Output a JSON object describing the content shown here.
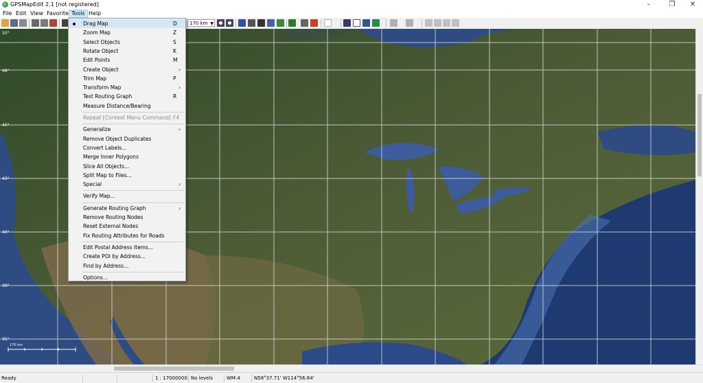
{
  "window": {
    "title": "GPSMapEdit 2.1 [not registered]",
    "controls": [
      "–",
      "❐",
      "✕"
    ]
  },
  "menubar": [
    "File",
    "Edit",
    "View",
    "Favorites",
    "Tools",
    "Help"
  ],
  "toolbar": {
    "scale": "170 km",
    "icons": [
      "open-icon",
      "save-icon",
      "save-as-icon",
      "print-icon",
      "print-preview-icon",
      "undo-icon",
      "zoom-in-icon",
      "zoom-out-icon",
      "label-icon",
      "ruler-icon",
      "grid-icon",
      "layers-icon",
      "routing-icon",
      "select-icon",
      "map-icon",
      "settings-icon",
      "google-icon",
      "tiles-icon",
      "page-icon",
      "gps-icon",
      "map-green-icon",
      "undo-arrow-icon",
      "redo-arrow-icon",
      "cut-icon",
      "copy-icon",
      "paste-icon",
      "delete-icon"
    ]
  },
  "tools_menu": {
    "items": [
      {
        "label": "Drag Map",
        "shortcut": "D",
        "checked": true
      },
      {
        "label": "Zoom Map",
        "shortcut": "Z"
      },
      {
        "label": "Select Objects",
        "shortcut": "S"
      },
      {
        "label": "Rotate Object",
        "shortcut": "K"
      },
      {
        "label": "Edit Points",
        "shortcut": "M"
      },
      {
        "label": "Create Object",
        "submenu": true
      },
      {
        "label": "Trim Map",
        "shortcut": "P"
      },
      {
        "label": "Transform Map",
        "submenu": true
      },
      {
        "label": "Test Routing Graph",
        "shortcut": "R"
      },
      {
        "label": "Measure Distance/Bearing"
      },
      {
        "separator": true
      },
      {
        "label": "Repeat [Context Menu Command]",
        "shortcut": "F4",
        "disabled": true
      },
      {
        "separator": true
      },
      {
        "label": "Generalize",
        "submenu": true
      },
      {
        "label": "Remove Object Duplicates"
      },
      {
        "label": "Convert Labels..."
      },
      {
        "label": "Merge Inner Polygons"
      },
      {
        "label": "Slice All Objects..."
      },
      {
        "label": "Split Map to Files..."
      },
      {
        "label": "Special",
        "submenu": true
      },
      {
        "separator": true
      },
      {
        "label": "Verify Map..."
      },
      {
        "separator": true
      },
      {
        "label": "Generate Routing Graph",
        "submenu": true
      },
      {
        "label": "Remove Routing Nodes"
      },
      {
        "label": "Reset External Nodes"
      },
      {
        "label": "Fix Routing Attributes for Roads"
      },
      {
        "separator": true
      },
      {
        "label": "Edit Postal Address Items..."
      },
      {
        "label": "Create POI by Address..."
      },
      {
        "label": "Find by Address..."
      },
      {
        "separator": true
      },
      {
        "label": "Options..."
      }
    ]
  },
  "map": {
    "scale_bar_label": "170 km",
    "grid_labels": [
      "50°",
      "48°",
      "45°",
      "43°",
      "40°",
      "38°",
      "35°",
      "33°"
    ]
  },
  "statusbar": {
    "status": "Ready",
    "scale": "1 : 17000000",
    "levels": "No levels",
    "wm": "WM:4",
    "coords": "N58°37.71' W114°56.64'"
  }
}
